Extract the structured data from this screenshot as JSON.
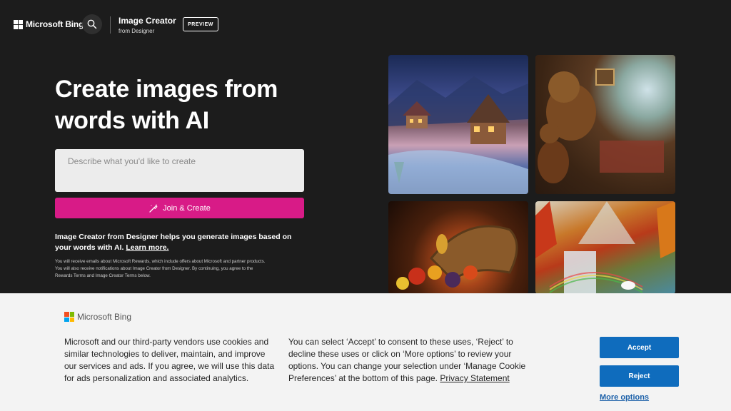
{
  "header": {
    "brand": "Microsoft Bing",
    "product_name": "Image Creator",
    "product_sub": "from Designer",
    "preview_badge": "PREVIEW",
    "search_icon": "search-icon"
  },
  "hero": {
    "title": "Create images from words with AI",
    "prompt_placeholder": "Describe what you'd like to create",
    "join_button": "Join & Create",
    "description": "Image Creator from Designer helps you generate images based on your words with AI.",
    "learn_more": "Learn more.",
    "fine_print": "You will receive emails about Microsoft Rewards, which include offers about Microsoft and partner products. You will also receive notifications about Image Creator from Designer. By continuing, you agree to the Rewards Terms and Image Creator Terms below."
  },
  "gallery": {
    "tiles": [
      "winter-village-image",
      "bears-cave-image",
      "cornucopia-image",
      "waterfall-unicorn-image"
    ]
  },
  "cookie_banner": {
    "brand": "Microsoft Bing",
    "text_left": "Microsoft and our third-party vendors use cookies and similar technologies to deliver, maintain, and improve our services and ads. If you agree, we will use this data for ads personalization and associated analytics.",
    "text_right": "You can select ‘Accept’ to consent to these uses, ‘Reject’ to decline these uses or click on ‘More options’ to review your options. You can change your selection under ‘Manage Cookie Preferences’ at the bottom of this page.",
    "privacy_link": "Privacy Statement",
    "accept": "Accept",
    "reject": "Reject",
    "more_options": "More options"
  },
  "colors": {
    "background": "#1c1c1c",
    "join_button": "#d81b87",
    "primary_button": "#0f6cbd"
  }
}
